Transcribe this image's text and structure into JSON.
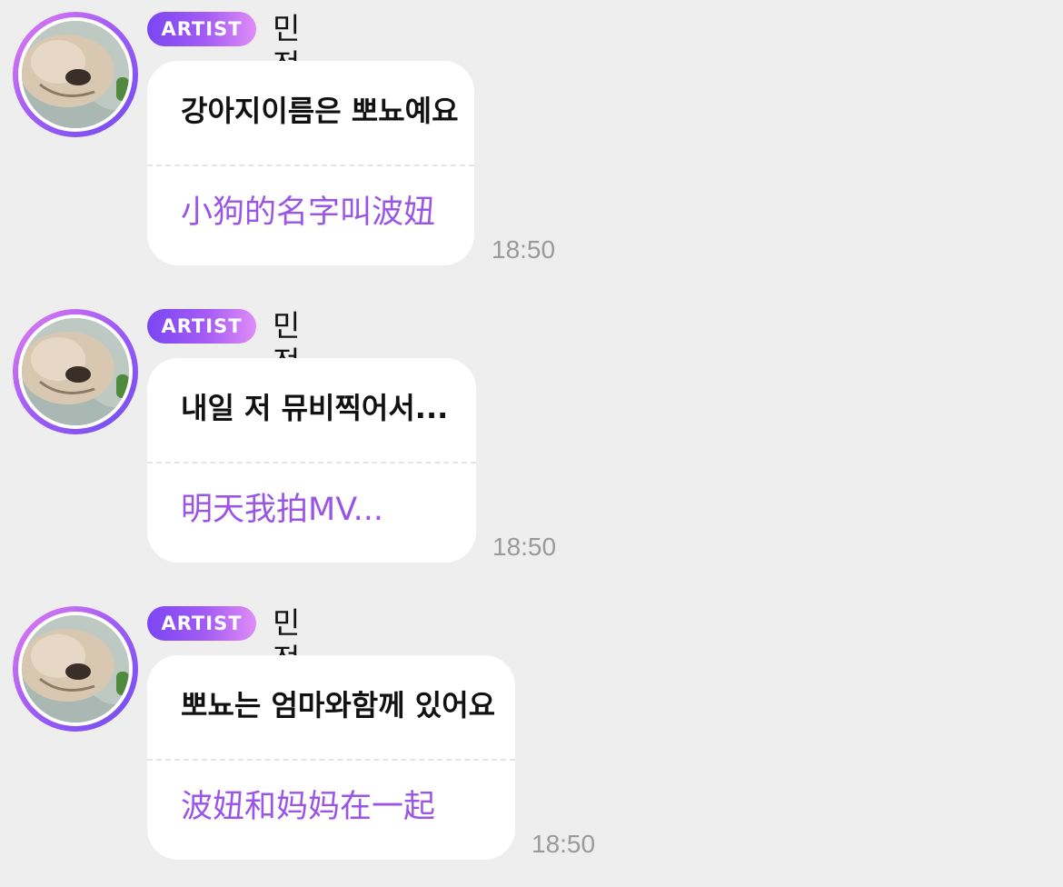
{
  "messages": [
    {
      "badge": "ARTIST",
      "sender": "민정이",
      "text": "강아지이름은 뽀뇨예요",
      "translation": "小狗的名字叫波妞",
      "time": "18:50"
    },
    {
      "badge": "ARTIST",
      "sender": "민정이",
      "text": "내일 저 뮤비찍어서...",
      "translation": "明天我拍MV...",
      "time": "18:50"
    },
    {
      "badge": "ARTIST",
      "sender": "민정이",
      "text": "뽀뇨는 엄마와함께 있어요",
      "translation": "波妞和妈妈在一起",
      "time": "18:50"
    }
  ]
}
